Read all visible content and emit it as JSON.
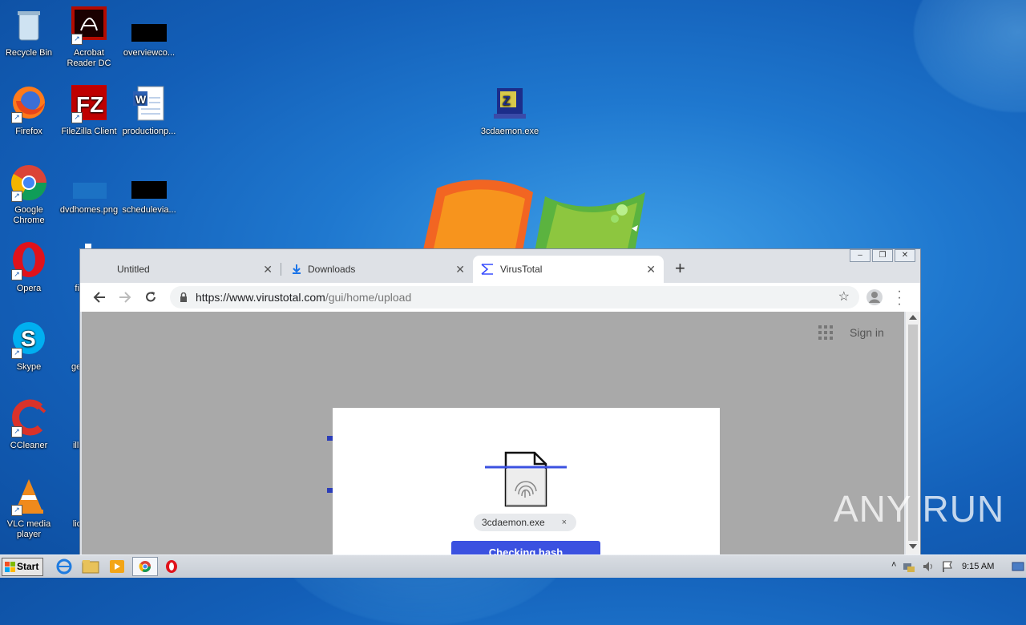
{
  "desktop": {
    "icons": [
      {
        "label": "Recycle Bin",
        "icon": "recycle-bin-icon"
      },
      {
        "label": "Acrobat Reader DC",
        "icon": "acrobat-icon"
      },
      {
        "label": "overviewco...",
        "icon": "file-icon"
      },
      {
        "label": "Firefox",
        "icon": "firefox-icon"
      },
      {
        "label": "FileZilla Client",
        "icon": "filezilla-icon"
      },
      {
        "label": "productionp...",
        "icon": "word-doc-icon"
      },
      {
        "label": "3cdaemon.exe",
        "icon": "exe-icon"
      },
      {
        "label": "Google Chrome",
        "icon": "chrome-icon"
      },
      {
        "label": "dvdhomes.png",
        "icon": "image-file-icon"
      },
      {
        "label": "schedulevia...",
        "icon": "file-icon"
      },
      {
        "label": "Opera",
        "icon": "opera-icon"
      },
      {
        "label": "fir",
        "icon": "file-icon"
      },
      {
        "label": "Skype",
        "icon": "skype-icon"
      },
      {
        "label": "geor",
        "icon": "file-icon"
      },
      {
        "label": "CCleaner",
        "icon": "ccleaner-icon"
      },
      {
        "label": "illino",
        "icon": "file-icon"
      },
      {
        "label": "VLC media player",
        "icon": "vlc-icon"
      },
      {
        "label": "licen",
        "icon": "file-icon"
      }
    ]
  },
  "browser": {
    "tabs": [
      {
        "label": "Untitled",
        "icon": ""
      },
      {
        "label": "Downloads",
        "icon": "download-icon"
      },
      {
        "label": "VirusTotal",
        "icon": "virustotal-icon"
      }
    ],
    "url": {
      "scheme_host": "https://www.virustotal.com",
      "path": "/gui/home/upload"
    },
    "page": {
      "sign_in": "Sign in",
      "file_name": "3cdaemon.exe",
      "chip_close": "×",
      "button_label": "Checking hash"
    }
  },
  "taskbar": {
    "start_label": "Start",
    "clock": "9:15 AM"
  },
  "watermark": "ANY RUN",
  "colors": {
    "accent": "#3b51e0",
    "desktop": "#1f78cf"
  }
}
